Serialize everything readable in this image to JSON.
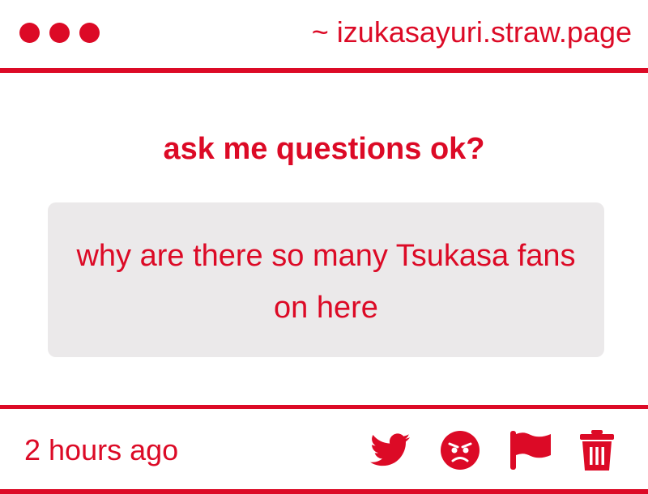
{
  "window": {
    "url": "~ izukasayuri.straw.page"
  },
  "page": {
    "prompt": "ask me questions ok?"
  },
  "question": {
    "text": "why are there so many Tsukasa fans on here"
  },
  "footer": {
    "timestamp": "2 hours ago",
    "actions": [
      {
        "icon": "twitter-icon"
      },
      {
        "icon": "angry-face-icon"
      },
      {
        "icon": "flag-icon"
      },
      {
        "icon": "trash-icon"
      }
    ]
  },
  "colors": {
    "accent": "#dc0a26",
    "question_bg": "#ebe9ea",
    "background": "#ffffff"
  }
}
